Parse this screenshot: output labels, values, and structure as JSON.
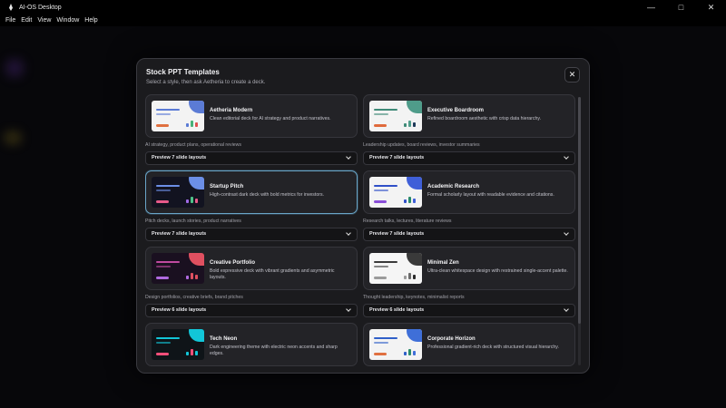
{
  "window": {
    "title": "AI-OS Desktop",
    "controls": {
      "minimize": "—",
      "maximize": "□",
      "close": "✕"
    }
  },
  "menu": {
    "items": [
      "File",
      "Edit",
      "View",
      "Window",
      "Help"
    ]
  },
  "modal": {
    "title": "Stock PPT Templates",
    "subtitle": "Select a style, then ask Aetheria to create a deck.",
    "close_label": "✕"
  },
  "templates": [
    {
      "name": "Aetheria Modern",
      "description": "Clean editorial deck for AI strategy and product narratives.",
      "tags": "AI strategy, product plans, operational reviews",
      "preview_label": "Preview 7 slide layouts",
      "selected": false,
      "thumb": {
        "bg": "#f3f3f3",
        "accent": "#5b7bd5",
        "line": "#5b7bd5",
        "pill": "#e07040",
        "bars": [
          "#5b7bd5",
          "#48b078",
          "#e05050"
        ]
      }
    },
    {
      "name": "Executive Boardroom",
      "description": "Refined boardroom aesthetic with crisp data hierarchy.",
      "tags": "Leadership updates, board reviews, investor summaries",
      "preview_label": "Preview 7 slide layouts",
      "selected": false,
      "thumb": {
        "bg": "#f3f3f3",
        "accent": "#4f9c8a",
        "line": "#3f8a78",
        "pill": "#e06a3c",
        "bars": [
          "#3f8a78",
          "#4f9c8a",
          "#1f3a5a"
        ]
      }
    },
    {
      "name": "Startup Pitch",
      "description": "High-contrast dark deck with bold metrics for investors.",
      "tags": "Pitch decks, launch stories, product narratives",
      "preview_label": "Preview 7 slide layouts",
      "selected": true,
      "thumb": {
        "bg": "#121320",
        "accent": "#6c8fe6",
        "line": "#6c8fe6",
        "pill": "#e85a8a",
        "bars": [
          "#a06ae6",
          "#4fc38a",
          "#e85a8a"
        ]
      }
    },
    {
      "name": "Academic Research",
      "description": "Formal scholarly layout with readable evidence and citations.",
      "tags": "Research talks, lectures, literature reviews",
      "preview_label": "Preview 7 slide layouts",
      "selected": false,
      "thumb": {
        "bg": "#f3f3f3",
        "accent": "#3f5fd8",
        "line": "#2f4fc8",
        "pill": "#8a4fd8",
        "bars": [
          "#2f4fc8",
          "#2a8a6a",
          "#3f5fd8"
        ]
      }
    },
    {
      "name": "Creative Portfolio",
      "description": "Bold expressive deck with vibrant gradients and asymmetric layouts.",
      "tags": "Design portfolios, creative briefs, brand pitches",
      "preview_label": "Preview 6 slide layouts",
      "selected": false,
      "thumb": {
        "bg": "#1a1020",
        "accent": "#e05060",
        "line": "#c04aa0",
        "pill": "#b06ae0",
        "bars": [
          "#b06ae0",
          "#e05060",
          "#e05060"
        ]
      }
    },
    {
      "name": "Minimal Zen",
      "description": "Ultra-clean whitespace design with restrained single-accent palette.",
      "tags": "Thought leadership, keynotes, minimalist reports",
      "preview_label": "Preview 6 slide layouts",
      "selected": false,
      "thumb": {
        "bg": "#f5f5f5",
        "accent": "#3a3a3a",
        "line": "#3a3a3a",
        "pill": "#9a9a9a",
        "bars": [
          "#9a9a9a",
          "#6a6a6a",
          "#2a2a2a"
        ]
      }
    },
    {
      "name": "Tech Neon",
      "description": "Dark engineering theme with electric neon accents and sharp edges.",
      "tags": "",
      "preview_label": "",
      "selected": false,
      "thumb": {
        "bg": "#0f1418",
        "accent": "#12c6d8",
        "line": "#12c6d8",
        "pill": "#ff4f7a",
        "bars": [
          "#12c6d8",
          "#ff4f7a",
          "#12c6d8"
        ]
      }
    },
    {
      "name": "Corporate Horizon",
      "description": "Professional gradient-rich deck with structured visual hierarchy.",
      "tags": "",
      "preview_label": "",
      "selected": false,
      "thumb": {
        "bg": "#f3f3f3",
        "accent": "#3f6fd8",
        "line": "#2f5fc8",
        "pill": "#e07040",
        "bars": [
          "#2f5fc8",
          "#2a8a6a",
          "#3f6fd8"
        ]
      }
    }
  ]
}
